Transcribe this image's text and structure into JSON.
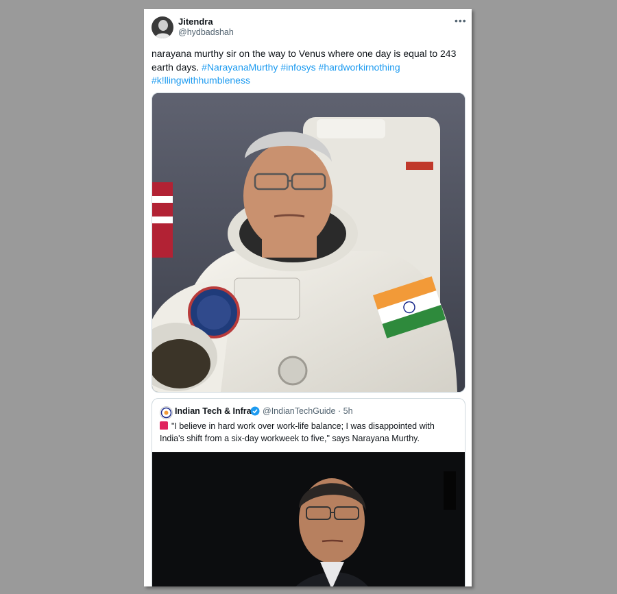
{
  "author": {
    "name": "Jitendra",
    "handle": "@hydbadshah"
  },
  "more_icon": "more-horizontal-icon",
  "tweet": {
    "text_plain": "narayana murthy sir on the way to Venus where one day is equal to 243 earth days.",
    "hashtags": [
      "#NarayanaMurthy",
      "#infosys",
      "#hardworkirnothing",
      "#k!llingwithhumbleness"
    ]
  },
  "quoted": {
    "name": "Indian Tech & Infra",
    "handle": "@IndianTechGuide",
    "separator": "·",
    "time": "5h",
    "verified_icon": "verified-badge-icon",
    "text": "\"I believe in hard work over work-life balance; I was disappointed with India's shift from a six-day workweek to five,\" says Narayana Murthy.",
    "emoji_icon": "siren-emoji-icon"
  },
  "colors": {
    "link": "#1d9bf0",
    "text": "#0f1419",
    "muted": "#536471",
    "border": "#cfd9de",
    "backdrop": "#9a9a9a"
  }
}
